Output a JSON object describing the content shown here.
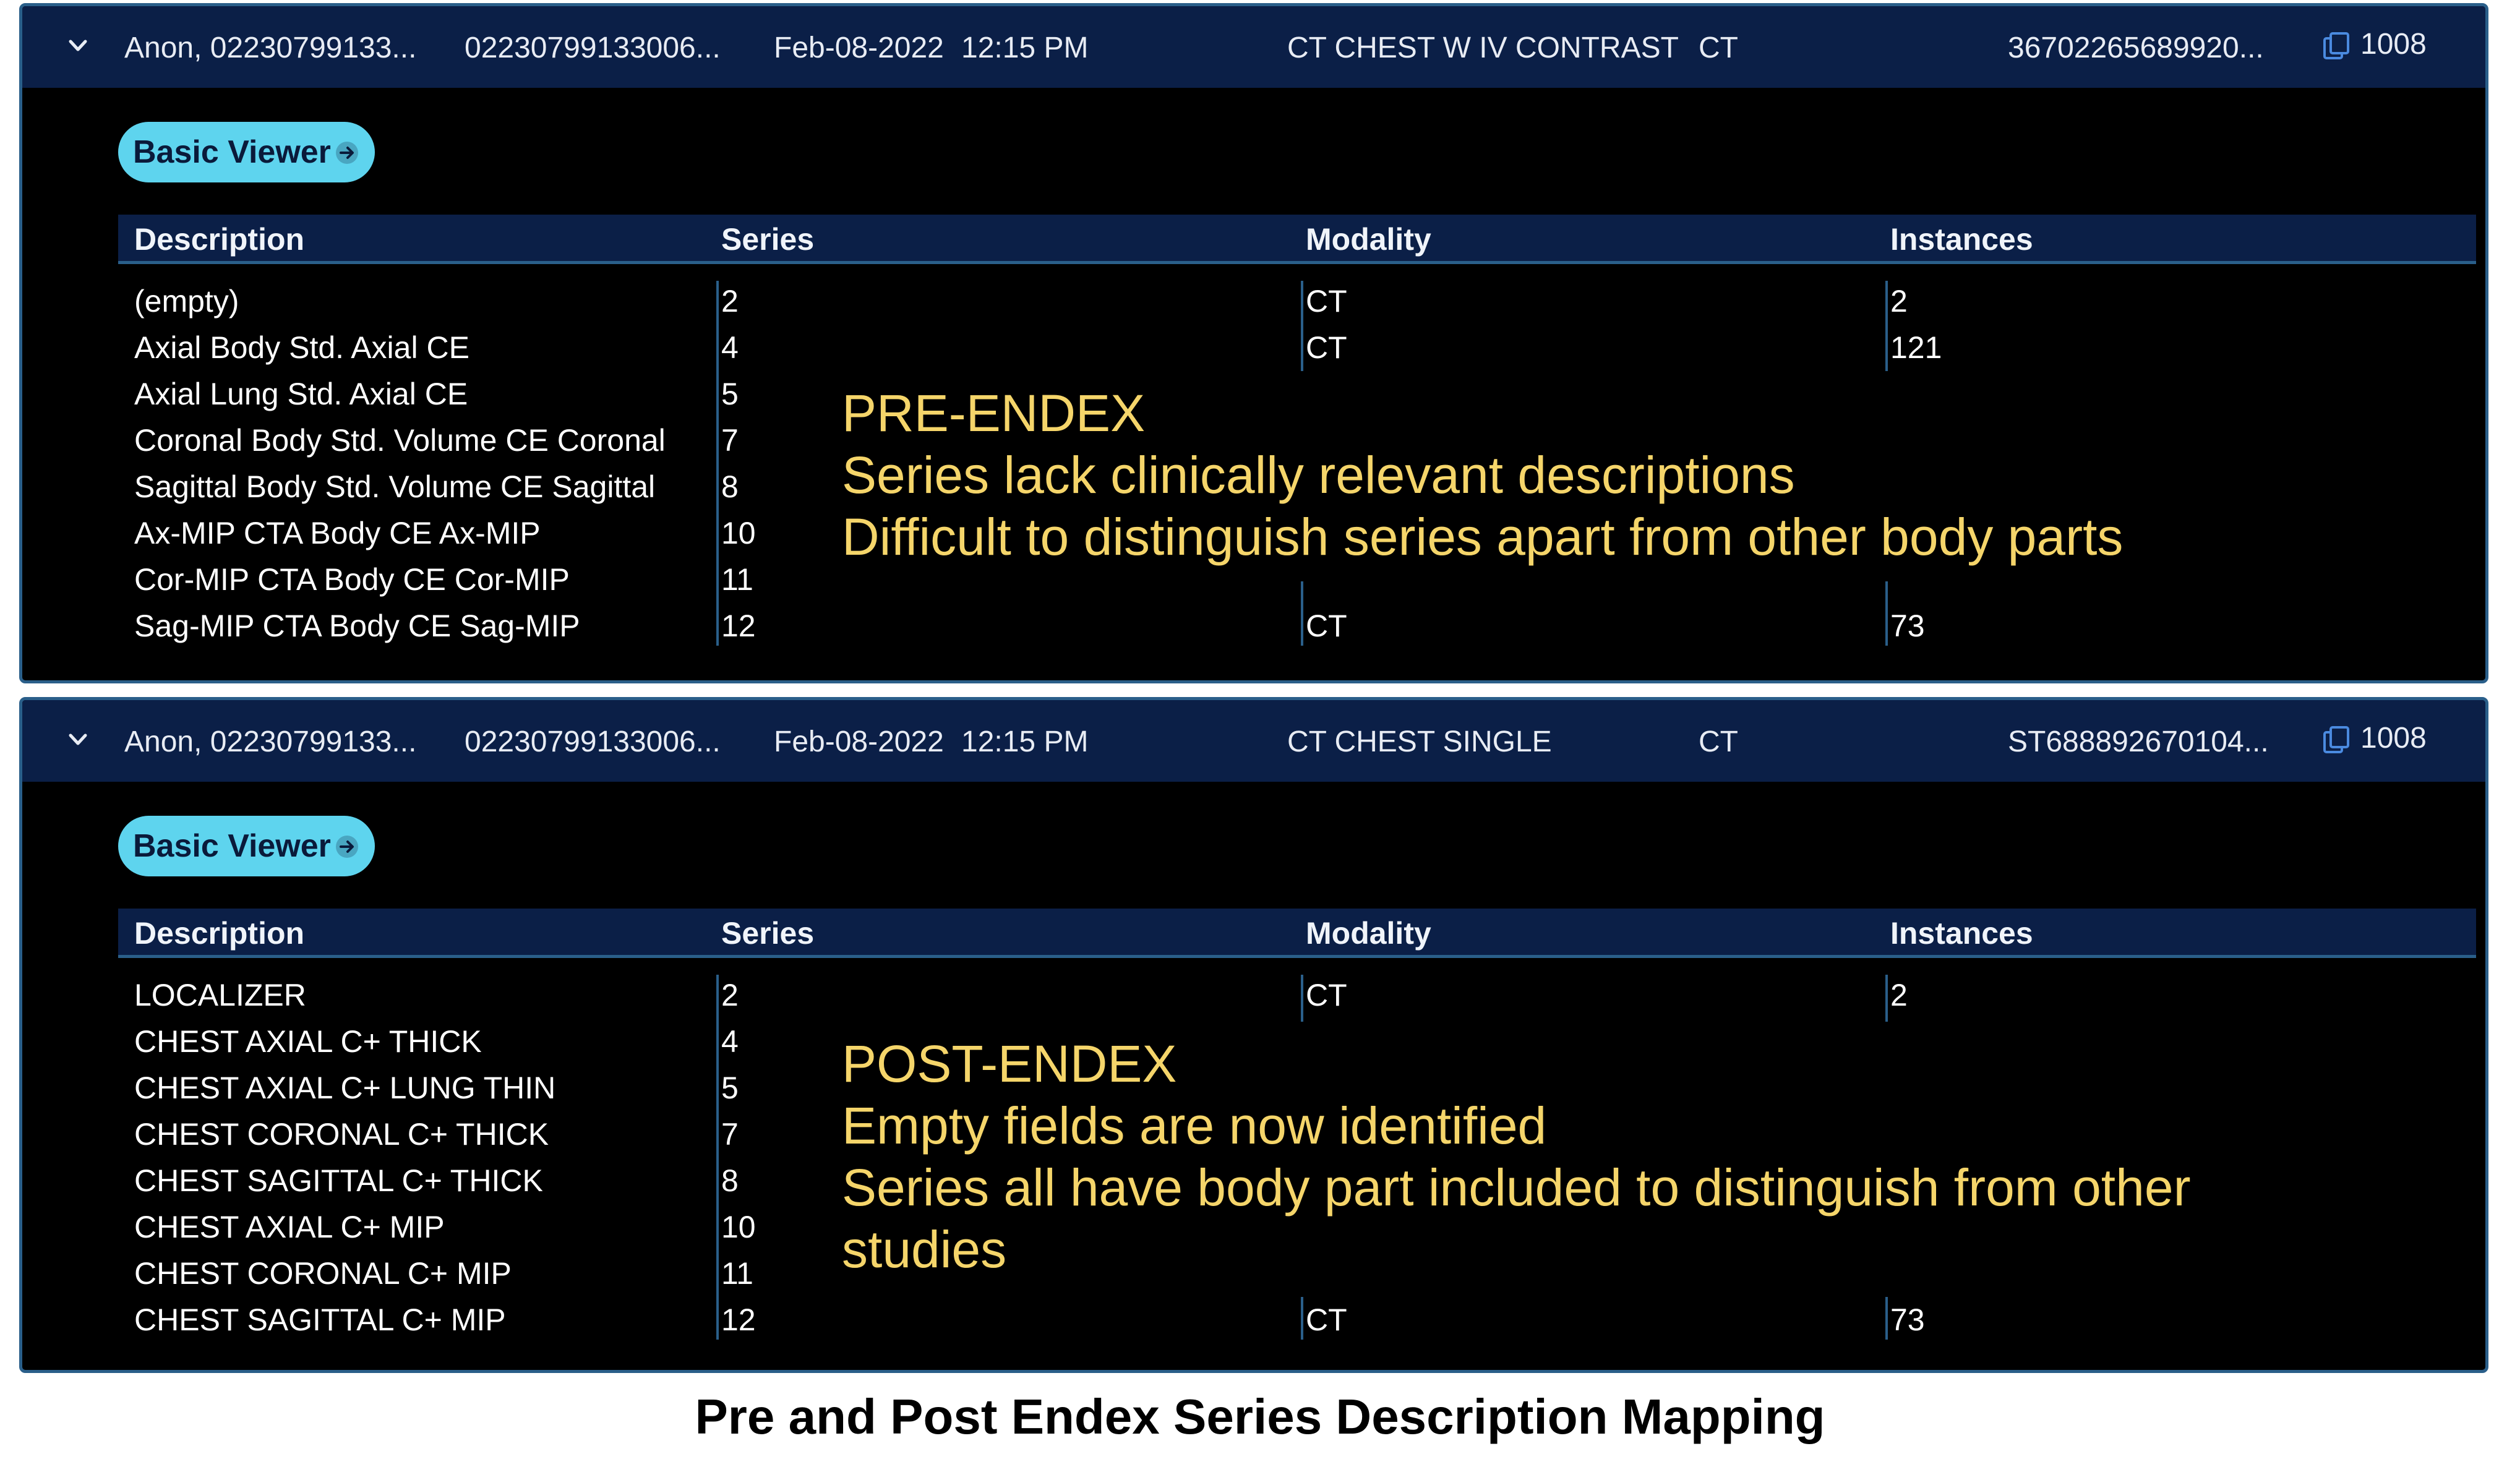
{
  "studies": [
    {
      "header": {
        "patient": "Anon, 02230799133...",
        "mrn": "02230799133006...",
        "date": "Feb-08-2022",
        "time": "12:15 PM",
        "description": "CT CHEST W IV CONTRAST",
        "modality": "CT",
        "accession": "36702265689920...",
        "instance_count": "1008"
      },
      "viewer_button": "Basic Viewer",
      "columns": [
        "Description",
        "Series",
        "Modality",
        "Instances"
      ],
      "rows": [
        {
          "description": "(empty)",
          "series": "2",
          "modality": "CT",
          "instances": "2"
        },
        {
          "description": "Axial Body Std. Axial CE",
          "series": "4",
          "modality": "CT",
          "instances": "121"
        },
        {
          "description": "Axial Lung Std. Axial CE",
          "series": "5",
          "modality": "",
          "instances": ""
        },
        {
          "description": "Coronal Body Std. Volume CE Coronal",
          "series": "7",
          "modality": "",
          "instances": ""
        },
        {
          "description": "Sagittal Body Std. Volume CE Sagittal",
          "series": "8",
          "modality": "",
          "instances": ""
        },
        {
          "description": "Ax-MIP CTA Body CE Ax-MIP",
          "series": "10",
          "modality": "",
          "instances": ""
        },
        {
          "description": "Cor-MIP CTA Body CE Cor-MIP",
          "series": "11",
          "modality": "",
          "instances": ""
        },
        {
          "description": "Sag-MIP CTA Body CE Sag-MIP",
          "series": "12",
          "modality": "CT",
          "instances": "73"
        }
      ],
      "annotation": {
        "title": "PRE-ENDEX",
        "lines": [
          "Series lack clinically relevant descriptions",
          "Difficult to distinguish series apart from other body parts"
        ]
      }
    },
    {
      "header": {
        "patient": "Anon, 02230799133...",
        "mrn": "02230799133006...",
        "date": "Feb-08-2022",
        "time": "12:15 PM",
        "description": "CT CHEST SINGLE",
        "modality": "CT",
        "accession": "ST688892670104...",
        "instance_count": "1008"
      },
      "viewer_button": "Basic Viewer",
      "columns": [
        "Description",
        "Series",
        "Modality",
        "Instances"
      ],
      "rows": [
        {
          "description": "LOCALIZER",
          "series": "2",
          "modality": "CT",
          "instances": "2"
        },
        {
          "description": "CHEST AXIAL C+ THICK",
          "series": "4",
          "modality": "",
          "instances": ""
        },
        {
          "description": "CHEST AXIAL C+ LUNG THIN",
          "series": "5",
          "modality": "",
          "instances": ""
        },
        {
          "description": "CHEST CORONAL C+ THICK",
          "series": "7",
          "modality": "",
          "instances": ""
        },
        {
          "description": "CHEST SAGITTAL C+ THICK",
          "series": "8",
          "modality": "",
          "instances": ""
        },
        {
          "description": "CHEST AXIAL C+ MIP",
          "series": "10",
          "modality": "",
          "instances": ""
        },
        {
          "description": "CHEST CORONAL C+ MIP",
          "series": "11",
          "modality": "",
          "instances": ""
        },
        {
          "description": "CHEST SAGITTAL C+ MIP",
          "series": "12",
          "modality": "CT",
          "instances": "73"
        }
      ],
      "annotation": {
        "title": "POST-ENDEX",
        "lines": [
          "Empty fields are now identified",
          "Series all have body part included to distinguish from other",
          "studies"
        ]
      }
    }
  ],
  "caption": "Pre and Post Endex Series Description Mapping",
  "colors": {
    "header_bg": "#0b1f47",
    "border": "#2a5f8a",
    "button": "#5ed4ee",
    "annotation": "#f5d56a"
  },
  "icons": {
    "expand": "chevron-down-icon",
    "copy": "copy-icon",
    "arrow": "arrow-right-circle-icon"
  }
}
